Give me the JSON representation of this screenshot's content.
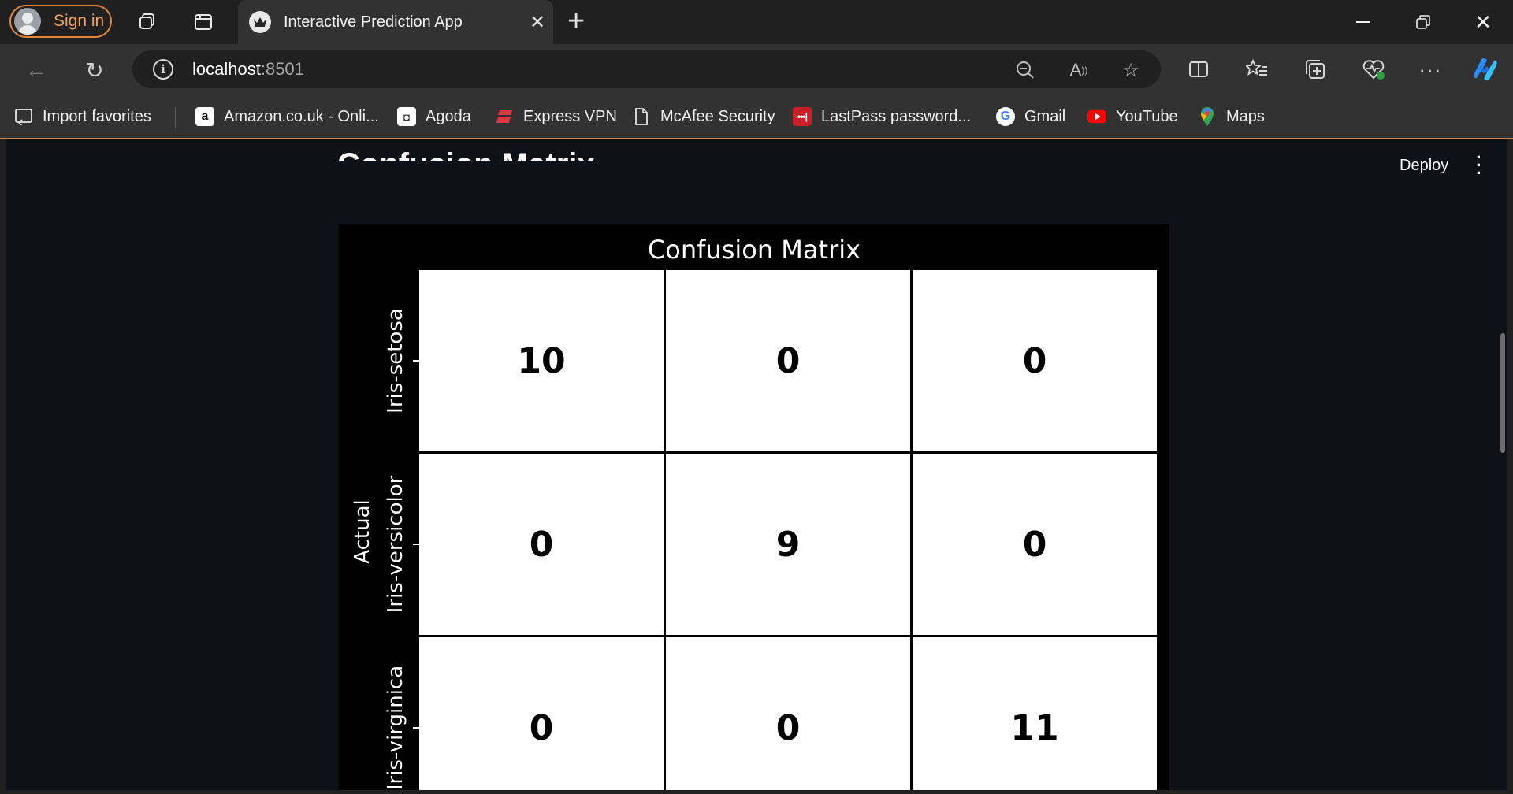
{
  "browser": {
    "signin_label": "Sign in",
    "tab_title": "Interactive Prediction App",
    "url_host": "localhost",
    "url_port": ":8501"
  },
  "favorites": [
    {
      "label": "Import favorites",
      "icon": "import-favorites-icon"
    },
    {
      "label": "Amazon.co.uk - Onli...",
      "icon": "amazon-icon"
    },
    {
      "label": "Agoda",
      "icon": "agoda-icon"
    },
    {
      "label": "Express VPN",
      "icon": "expressvpn-icon"
    },
    {
      "label": "McAfee Security",
      "icon": "page-icon"
    },
    {
      "label": "LastPass password...",
      "icon": "lastpass-icon"
    },
    {
      "label": "Gmail",
      "icon": "google-icon"
    },
    {
      "label": "YouTube",
      "icon": "youtube-icon"
    },
    {
      "label": "Maps",
      "icon": "maps-icon"
    }
  ],
  "app": {
    "deploy_label": "Deploy",
    "section_heading": "Confusion Matrix"
  },
  "chart_data": {
    "type": "heatmap",
    "title": "Confusion Matrix",
    "ylabel": "Actual",
    "row_labels": [
      "Iris-setosa",
      "Iris-versicolor",
      "Iris-virginica"
    ],
    "values": [
      [
        10,
        0,
        0
      ],
      [
        0,
        9,
        0
      ],
      [
        0,
        0,
        11
      ]
    ],
    "colors": {
      "background": "#000000",
      "cell": "#ffffff",
      "text": "#000000"
    }
  },
  "colors": {
    "page_bg": "#0e1117",
    "chrome_bg": "#202020",
    "toolbar_bg": "#323232",
    "accent": "#e0863a"
  }
}
